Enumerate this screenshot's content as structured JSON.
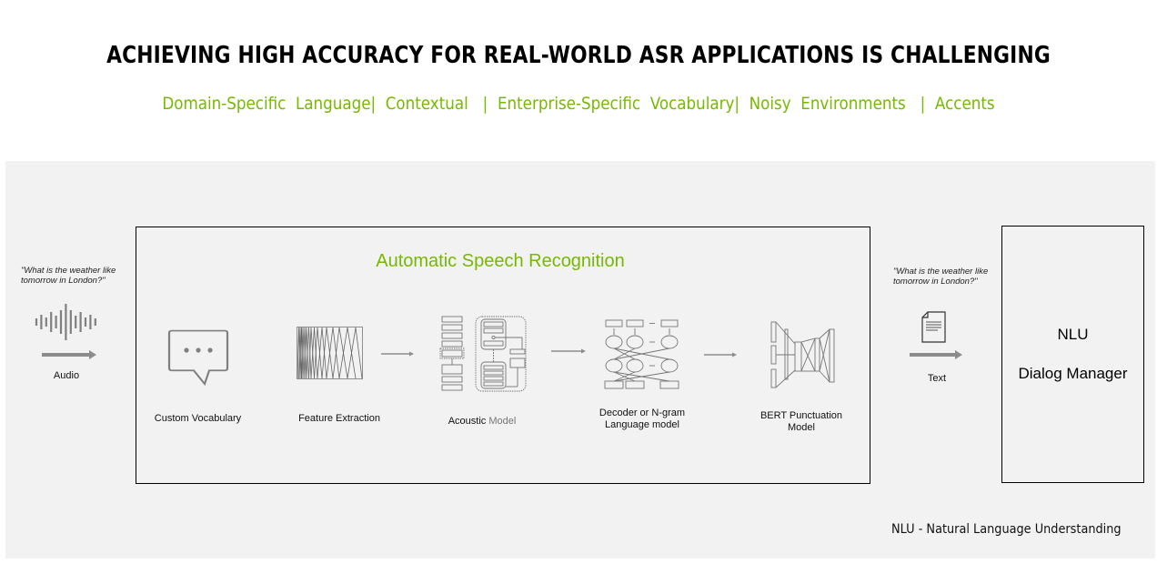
{
  "header": {
    "title": "ACHIEVING HIGH ACCURACY FOR REAL-WORLD ASR APPLICATIONS IS CHALLENGING",
    "subtitle": "Domain-Specific  Language|  Contextual   |  Enterprise-Specific  Vocabulary|  Noisy  Environments   |  Accents"
  },
  "colors": {
    "accent": "#76b900",
    "panel_bg": "#f2f2f2",
    "icon_grey": "#808080"
  },
  "input": {
    "quote": "\"What is the weather like tomorrow in London?\"",
    "quote_line1": "\"What is the weather like",
    "quote_line2": "tomorrow in London?\"",
    "label": "Audio",
    "icon": "audio-waveform-icon"
  },
  "asr": {
    "title": "Automatic  Speech  Recognition",
    "stages": [
      {
        "label": "Custom Vocabulary",
        "icon": "speech-bubble-icon"
      },
      {
        "label": "Feature Extraction",
        "icon": "filterbank-icon"
      },
      {
        "label_part1": "Acoustic",
        "label_part2": "Model",
        "icon": "acoustic-model-icon"
      },
      {
        "label_line1": "Decoder or N-gram",
        "label_line2": "Language model",
        "icon": "language-model-icon"
      },
      {
        "label_line1": "BERT  Punctuation",
        "label_line2": "Model",
        "icon": "bert-network-icon"
      }
    ]
  },
  "output": {
    "quote_line1": "\"What is the weather like",
    "quote_line2": "tomorrow in London?\"",
    "label": "Text",
    "icon": "document-icon"
  },
  "nlu": {
    "line1": "NLU",
    "line2": "Dialog Manager"
  },
  "footnote": "NLU - Natural Language Understanding"
}
